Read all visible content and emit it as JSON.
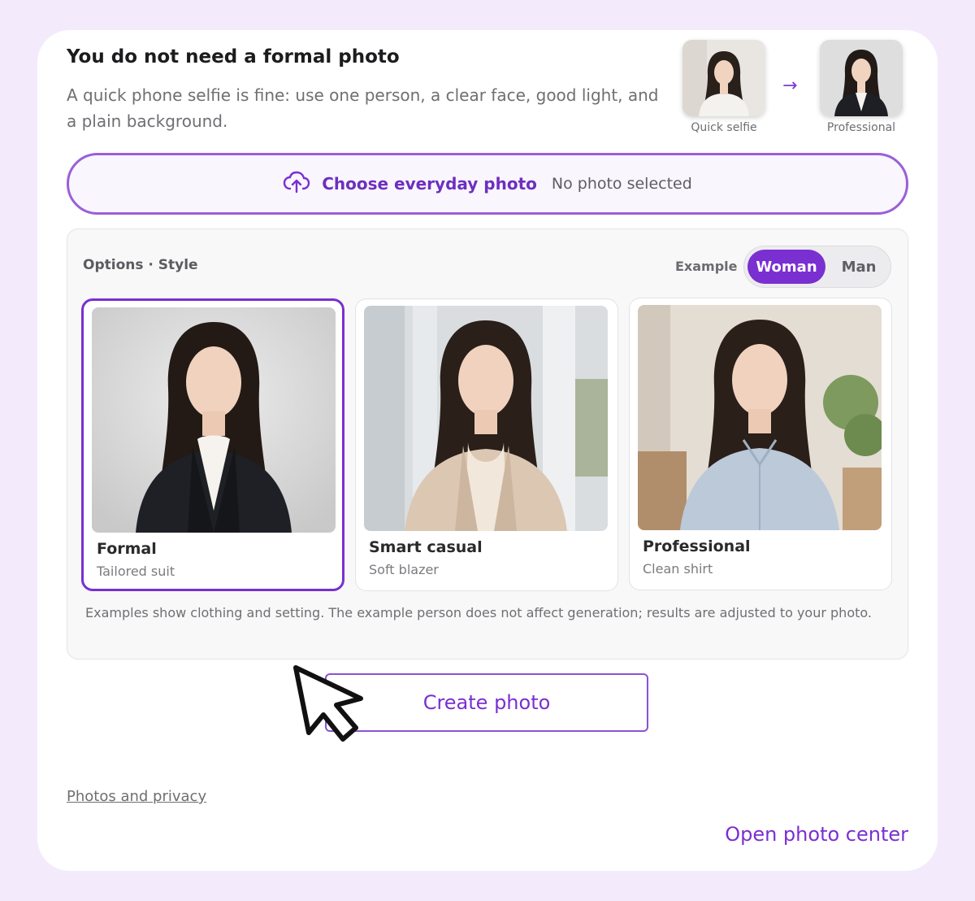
{
  "header": {
    "title": "You do not need a formal photo",
    "subtitle": "A quick phone selfie is fine: use one person, a clear face, good light, and a plain background."
  },
  "comparison": {
    "before_caption": "Quick selfie",
    "after_caption": "Professional",
    "arrow_icon": "arrow-right-icon"
  },
  "upload": {
    "icon": "cloud-upload-icon",
    "label": "Choose everyday photo",
    "status": "No photo selected"
  },
  "options": {
    "label": "Options · Style",
    "example_label": "Example",
    "toggle": {
      "woman": "Woman",
      "man": "Man",
      "selected": "Woman"
    },
    "styles": [
      {
        "name": "Formal",
        "desc": "Tailored suit",
        "selected": true
      },
      {
        "name": "Smart casual",
        "desc": "Soft blazer",
        "selected": false
      },
      {
        "name": "Professional",
        "desc": "Clean shirt",
        "selected": false
      }
    ],
    "note": "Examples show clothing and setting. The example person does not affect generation; results are adjusted to your photo."
  },
  "actions": {
    "create": "Create photo",
    "privacy": "Photos and privacy",
    "photo_center": "Open photo center"
  },
  "colors": {
    "accent": "#7a2fd1",
    "page_bg": "#f3ebfb",
    "upload_border": "#9a5fd8"
  }
}
